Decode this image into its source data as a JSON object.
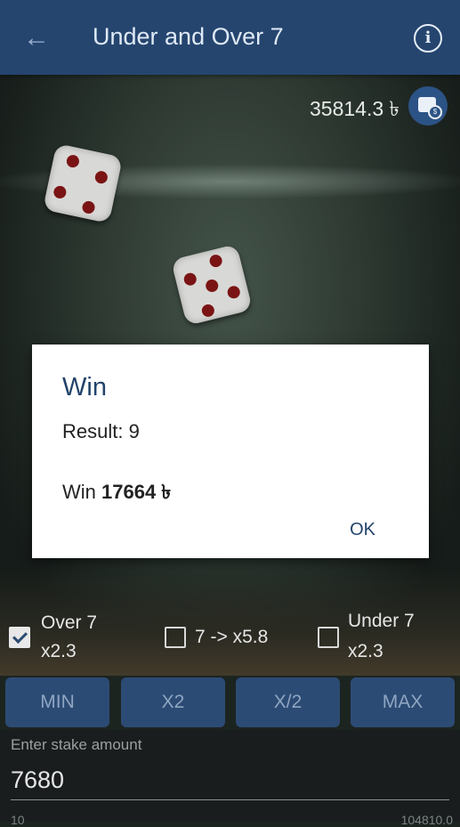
{
  "header": {
    "title": "Under and Over 7"
  },
  "balance": {
    "amount": "35814.3 ৳"
  },
  "dice": [
    {
      "value": 4
    },
    {
      "value": 5
    }
  ],
  "dialog": {
    "title": "Win",
    "result_text": "Result: 9",
    "win_label": "Win",
    "win_amount": "17664 ৳",
    "ok_label": "OK"
  },
  "bet_options": [
    {
      "line1": "Over 7",
      "line2": "x2.3",
      "checked": true
    },
    {
      "line1": "7 -> x5.8",
      "checked": false
    },
    {
      "line1": "Under 7",
      "line2": "x2.3",
      "checked": false
    }
  ],
  "buttons": {
    "min": "MIN",
    "x2": "X2",
    "half": "X/2",
    "max": "MAX"
  },
  "stake": {
    "label": "Enter stake amount",
    "value": "7680"
  },
  "footer": {
    "left": "10",
    "right": "104810.0"
  },
  "colors": {
    "appbar": "#25456f",
    "dialog_title": "#22436a",
    "pip": "#7a1414",
    "button": "#2c4b74"
  }
}
